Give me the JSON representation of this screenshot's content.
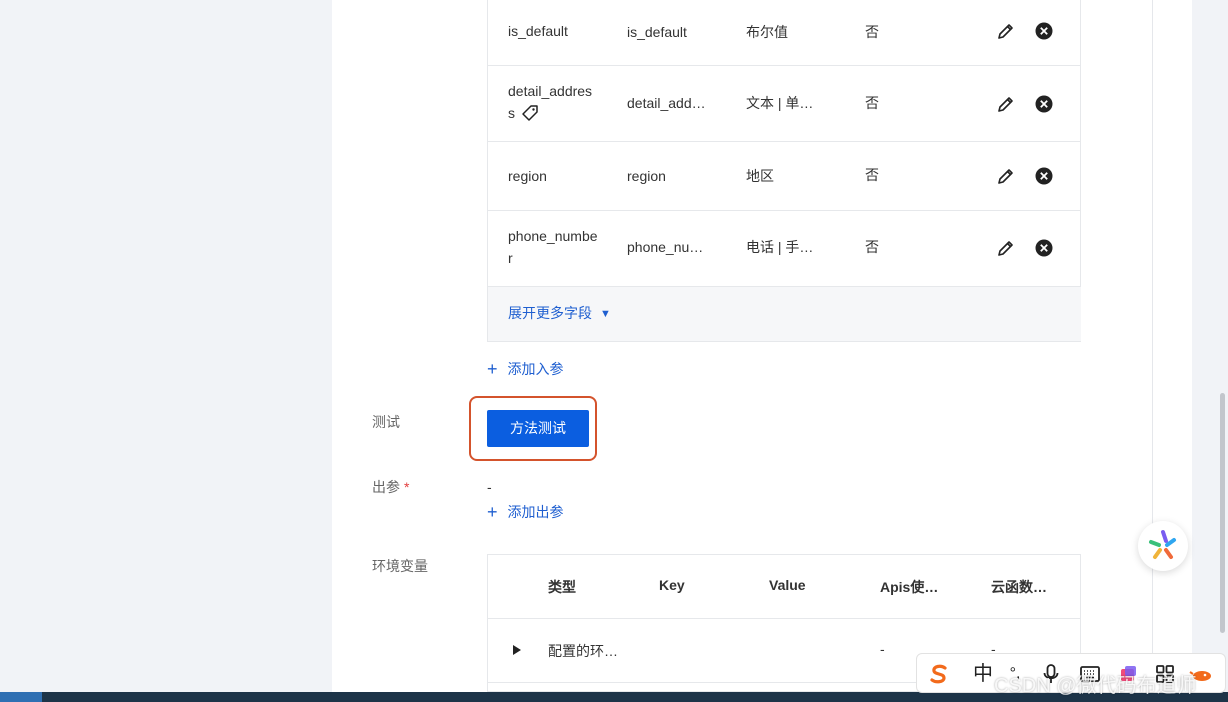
{
  "fields": {
    "rows": [
      {
        "name": "is_default",
        "label": "is_default",
        "type": "布尔值",
        "required": "否",
        "tag_icon": false
      },
      {
        "name": "detail_address",
        "label": "detail_add…",
        "type": "文本 | 单…",
        "required": "否",
        "tag_icon": true
      },
      {
        "name": "region",
        "label": "region",
        "type": "地区",
        "required": "否",
        "tag_icon": false
      },
      {
        "name": "phone_number",
        "label": "phone_nu…",
        "type": "电话 | 手…",
        "required": "否",
        "tag_icon": false
      }
    ],
    "expand_label": "展开更多字段",
    "add_input_label": "添加入参"
  },
  "test": {
    "label": "测试",
    "button_label": "方法测试"
  },
  "output": {
    "label": "出参",
    "required_mark": "*",
    "value": "-",
    "add_output_label": "添加出参"
  },
  "env": {
    "label": "环境变量",
    "headers": [
      "类型",
      "Key",
      "Value",
      "Apis使…",
      "云函数…"
    ],
    "rows": [
      {
        "type": "配置的环…",
        "key": "",
        "value": "",
        "apis": "-",
        "cloud": "-"
      }
    ]
  },
  "ime": {
    "items": [
      "S",
      "中",
      "°,",
      "mic",
      "kbd",
      "skin",
      "grid",
      "more"
    ],
    "zhong": "中",
    "punct": "°,"
  },
  "watermark": "CSDN @微代码布道师",
  "colors": {
    "primary": "#0b5ee0",
    "link": "#1f5fd0",
    "highlight": "#d4532c",
    "required": "#e23d3d"
  }
}
